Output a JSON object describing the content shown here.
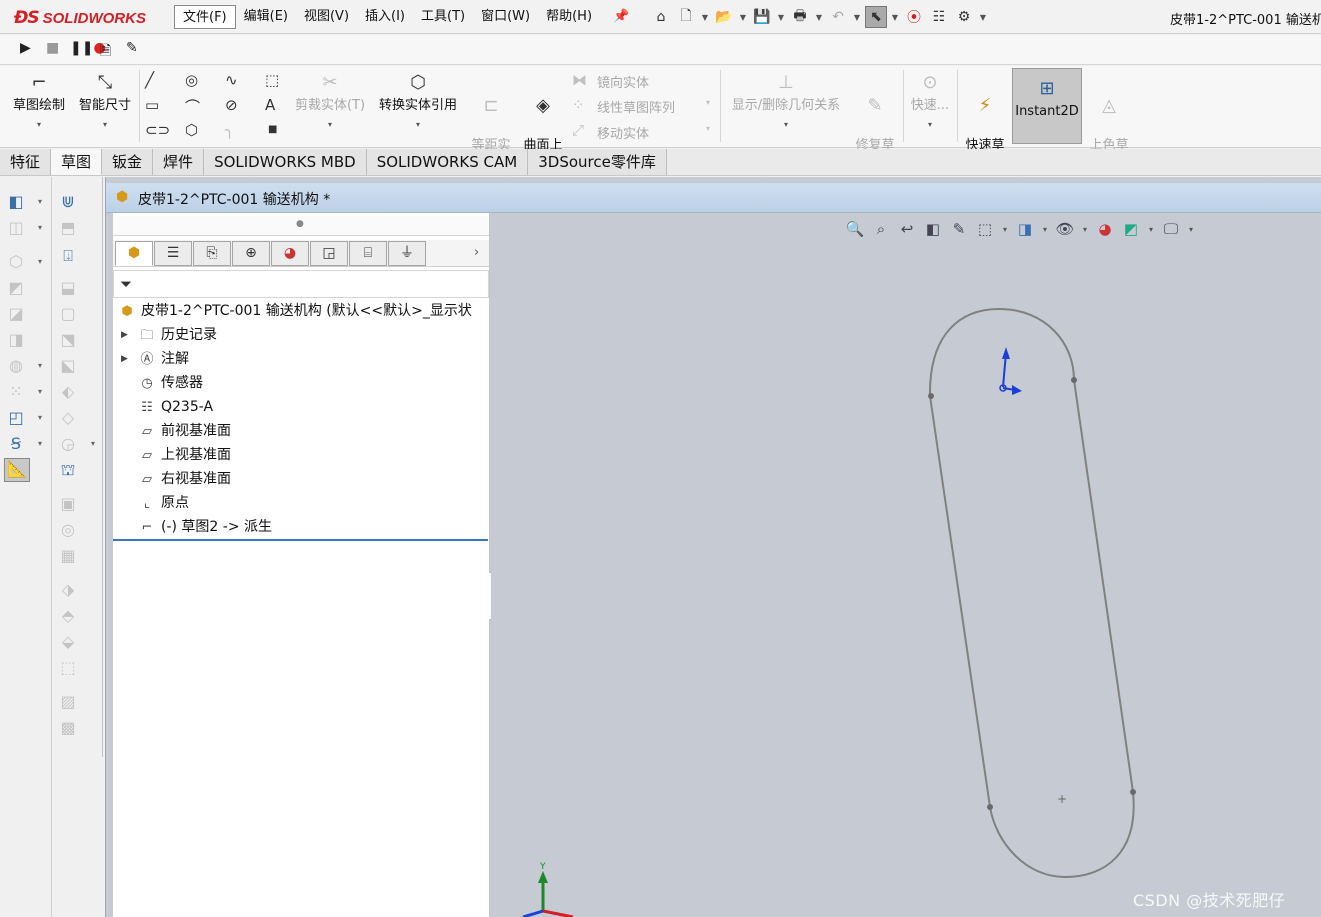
{
  "app": {
    "logo": "SOLIDWORKS",
    "document_title": "皮带1-2^PTC-001 输送机"
  },
  "menu": [
    "文件(F)",
    "编辑(E)",
    "视图(V)",
    "插入(I)",
    "工具(T)",
    "窗口(W)",
    "帮助(H)"
  ],
  "quick_access": [
    "home-icon",
    "new-document-icon",
    "open-icon",
    "save-icon",
    "print-icon",
    "undo-icon",
    "select-icon",
    "traffic-light-icon",
    "file-properties-icon",
    "options-gear-icon"
  ],
  "macro_bar": [
    "run-macro-icon",
    "stop-macro-icon",
    "record-macro-icon",
    "new-macro-icon",
    "edit-macro-icon"
  ],
  "command_manager": {
    "sketch": "草图绘制",
    "smart_dimension": "智能尺寸",
    "trim": "剪裁实体(T)",
    "convert": "转换实体引用",
    "offset_entities": "等距实\n体",
    "offset_surface": "曲面上\n偏移",
    "mirror": "镜向实体",
    "linear_pattern": "线性草图阵列",
    "move": "移动实体",
    "display_relations": "显示/删除几何关系",
    "repair_sketch": "修复草\n图",
    "quick_snaps": "快速...",
    "rapid_sketch": "快速草\n图",
    "instant2d": "Instant2D",
    "shaded_contours": "上色草\n图轮廓"
  },
  "tabs": [
    "特征",
    "草图",
    "钣金",
    "焊件",
    "SOLIDWORKS MBD",
    "SOLIDWORKS CAM",
    "3DSource零件库"
  ],
  "active_tab": "草图",
  "doc_window_title": "皮带1-2^PTC-001 输送机构 *",
  "feature_tree": {
    "root": "皮带1-2^PTC-001 输送机构  (默认<<默认>_显示状",
    "items": [
      {
        "label": "历史记录",
        "icon": "history-folder-icon",
        "expandable": true
      },
      {
        "label": "注解",
        "icon": "annotations-icon",
        "expandable": true
      },
      {
        "label": "传感器",
        "icon": "sensors-icon",
        "expandable": false
      },
      {
        "label": "Q235-A",
        "icon": "material-icon",
        "expandable": false
      },
      {
        "label": "前视基准面",
        "icon": "plane-icon",
        "expandable": false
      },
      {
        "label": "上视基准面",
        "icon": "plane-icon",
        "expandable": false
      },
      {
        "label": "右视基准面",
        "icon": "plane-icon",
        "expandable": false
      },
      {
        "label": "原点",
        "icon": "origin-icon",
        "expandable": false
      },
      {
        "label": "(-) 草图2 -> 派生",
        "icon": "sketch-icon",
        "expandable": false
      }
    ]
  },
  "watermark": "CSDN @技术死肥仔",
  "colors": {
    "brand_red": "#d61f26",
    "graphics_bg": "#c6cbd3",
    "sketch_line": "#808080",
    "axis_blue": "#1a3fd6",
    "axis_green": "#1a8a2a",
    "axis_red": "#d42020",
    "selection_blue": "#3b73c0"
  }
}
